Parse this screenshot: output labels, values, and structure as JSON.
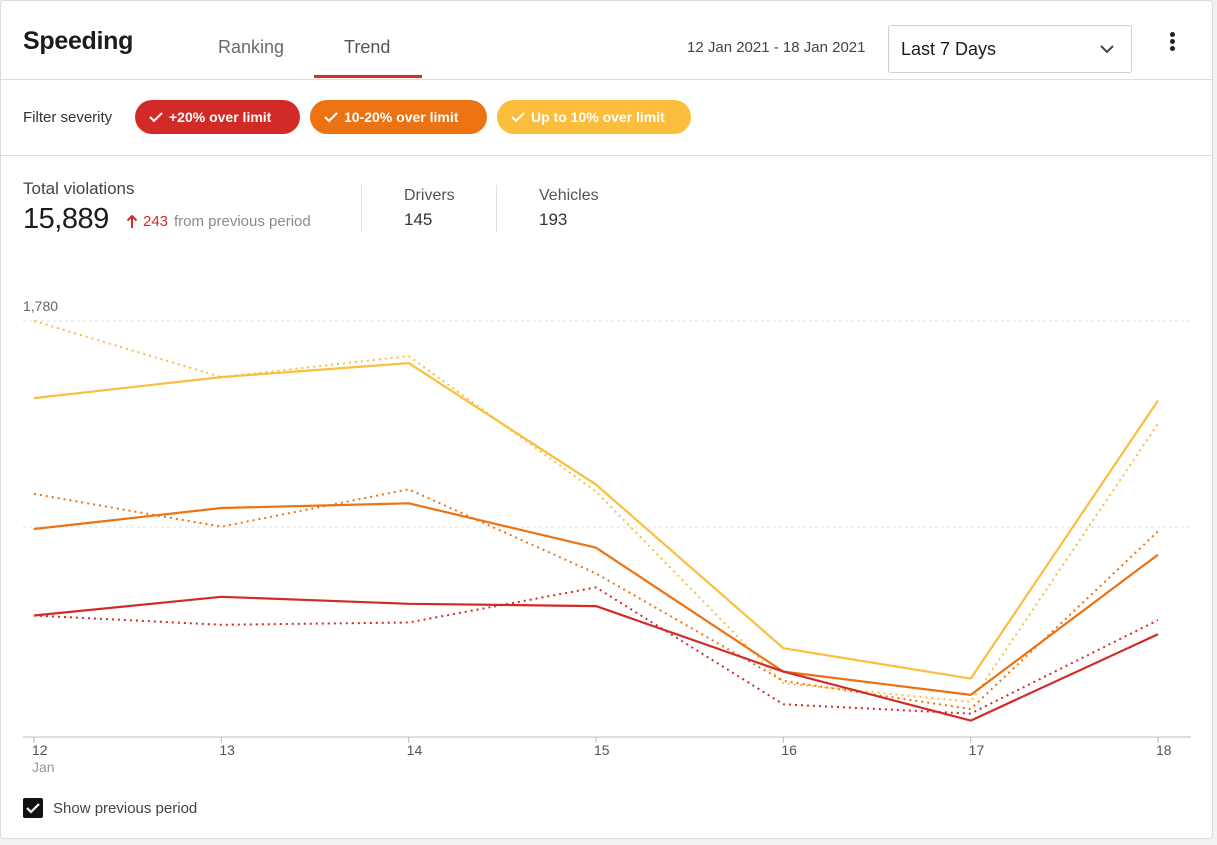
{
  "header": {
    "title": "Speeding",
    "tabs": [
      {
        "label": "Ranking",
        "active": false
      },
      {
        "label": "Trend",
        "active": true
      }
    ],
    "date_range": "12 Jan 2021 - 18 Jan 2021",
    "period_select": {
      "value": "Last 7 Days"
    }
  },
  "filters": {
    "label": "Filter severity",
    "chips": [
      {
        "label": "+20% over limit",
        "color": "#d22b27",
        "checked": true
      },
      {
        "label": "10-20% over limit",
        "color": "#ec7212",
        "checked": true
      },
      {
        "label": "Up to 10% over limit",
        "color": "#fbbd3c",
        "checked": true
      }
    ]
  },
  "summary": {
    "total_label": "Total violations",
    "total_value": "15,889",
    "delta_value": "243",
    "delta_text": "from previous period",
    "drivers_label": "Drivers",
    "drivers_value": "145",
    "vehicles_label": "Vehicles",
    "vehicles_value": "193"
  },
  "chart_data": {
    "type": "line",
    "categories": [
      "12",
      "13",
      "14",
      "15",
      "16",
      "17",
      "18"
    ],
    "first_tick_sublabel": "Jan",
    "y_max_label": "1,780",
    "ylim": [
      0,
      1780
    ],
    "grid": true,
    "series": [
      {
        "severity": "up-to-10",
        "color": "#fbbd3c",
        "style": "solid",
        "values": [
          1450,
          1540,
          1600,
          1080,
          380,
          250,
          1440
        ]
      },
      {
        "severity": "10-20",
        "color": "#ec7212",
        "style": "solid",
        "values": [
          890,
          980,
          1000,
          810,
          280,
          180,
          780
        ]
      },
      {
        "severity": "over-20",
        "color": "#d22b27",
        "style": "solid",
        "values": [
          520,
          600,
          570,
          560,
          280,
          70,
          440
        ]
      },
      {
        "severity": "up-to-10",
        "color": "#fbbd3c",
        "style": "dotted",
        "values": [
          1780,
          1540,
          1630,
          1050,
          230,
          150,
          1340
        ]
      },
      {
        "severity": "10-20",
        "color": "#ec7212",
        "style": "dotted",
        "values": [
          1040,
          900,
          1060,
          700,
          240,
          120,
          880
        ]
      },
      {
        "severity": "over-20",
        "color": "#d22b27",
        "style": "dotted",
        "values": [
          520,
          480,
          490,
          640,
          140,
          100,
          500
        ]
      }
    ]
  },
  "footer": {
    "show_previous_label": "Show previous period",
    "show_previous_checked": true
  }
}
